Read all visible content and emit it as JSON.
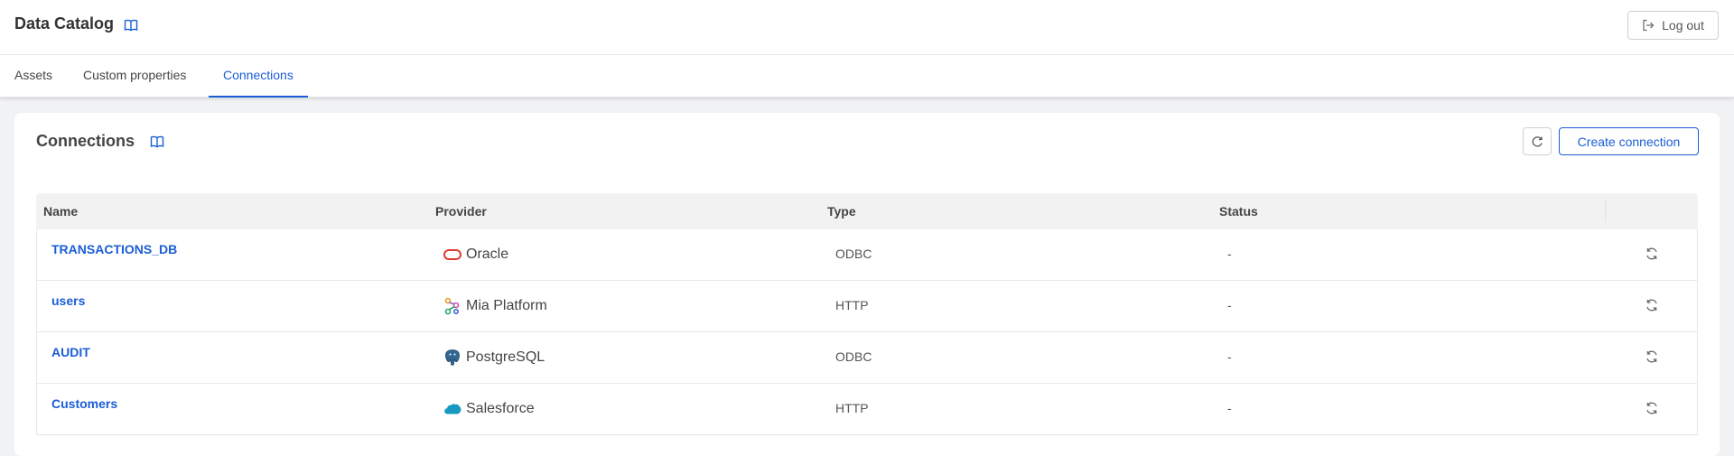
{
  "header": {
    "title": "Data Catalog",
    "logout_label": "Log out"
  },
  "tabs": [
    {
      "label": "Assets",
      "active": false
    },
    {
      "label": "Custom properties",
      "active": false
    },
    {
      "label": "Connections",
      "active": true
    }
  ],
  "card": {
    "title": "Connections",
    "create_label": "Create connection"
  },
  "table": {
    "columns": [
      "Name",
      "Provider",
      "Type",
      "Status"
    ],
    "rows": [
      {
        "name": "TRANSACTIONS_DB",
        "provider": "Oracle",
        "provider_icon": "oracle-icon",
        "type": "ODBC",
        "status": "-"
      },
      {
        "name": "users",
        "provider": "Mia Platform",
        "provider_icon": "mia-platform-icon",
        "type": "HTTP",
        "status": "-"
      },
      {
        "name": "AUDIT",
        "provider": "PostgreSQL",
        "provider_icon": "postgresql-icon",
        "type": "ODBC",
        "status": "-"
      },
      {
        "name": "Customers",
        "provider": "Salesforce",
        "provider_icon": "salesforce-icon",
        "type": "HTTP",
        "status": "-"
      }
    ]
  },
  "colors": {
    "accent": "#1a5dd6",
    "oracle": "#e03a2f",
    "salesforce": "#1798c1",
    "postgresql": "#336791"
  }
}
